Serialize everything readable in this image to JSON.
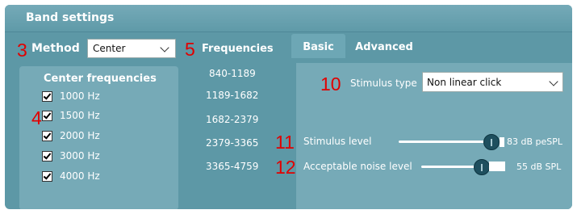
{
  "panel": {
    "title": "Band settings"
  },
  "annotations": {
    "a3": "3",
    "a4": "4",
    "a5": "5",
    "a10": "10",
    "a11": "11",
    "a12": "12"
  },
  "method": {
    "label": "Method",
    "selected": "Center"
  },
  "center_frequencies": {
    "title": "Center frequencies",
    "items": [
      {
        "label": "1000 Hz",
        "checked": true
      },
      {
        "label": "1500 Hz",
        "checked": true
      },
      {
        "label": "2000 Hz",
        "checked": true
      },
      {
        "label": "3000 Hz",
        "checked": true
      },
      {
        "label": "4000 Hz",
        "checked": true
      }
    ]
  },
  "frequencies": {
    "title": "Frequencies",
    "items": [
      "840-1189",
      "1189-1682",
      "1682-2379",
      "2379-3365",
      "3365-4759"
    ]
  },
  "tabs": {
    "basic": "Basic",
    "advanced": "Advanced",
    "active": "Basic"
  },
  "basic": {
    "stimulus_type": {
      "label": "Stimulus type",
      "selected": "Non linear click"
    },
    "stimulus_level": {
      "label": "Stimulus level",
      "value_text": "83 dB peSPL",
      "value": 83
    },
    "noise_level": {
      "label": "Acceptable noise level",
      "value_text": "55 dB SPL",
      "value": 55
    }
  },
  "colors": {
    "panel": "#5d98a6",
    "accent_annotation": "#e10000"
  }
}
